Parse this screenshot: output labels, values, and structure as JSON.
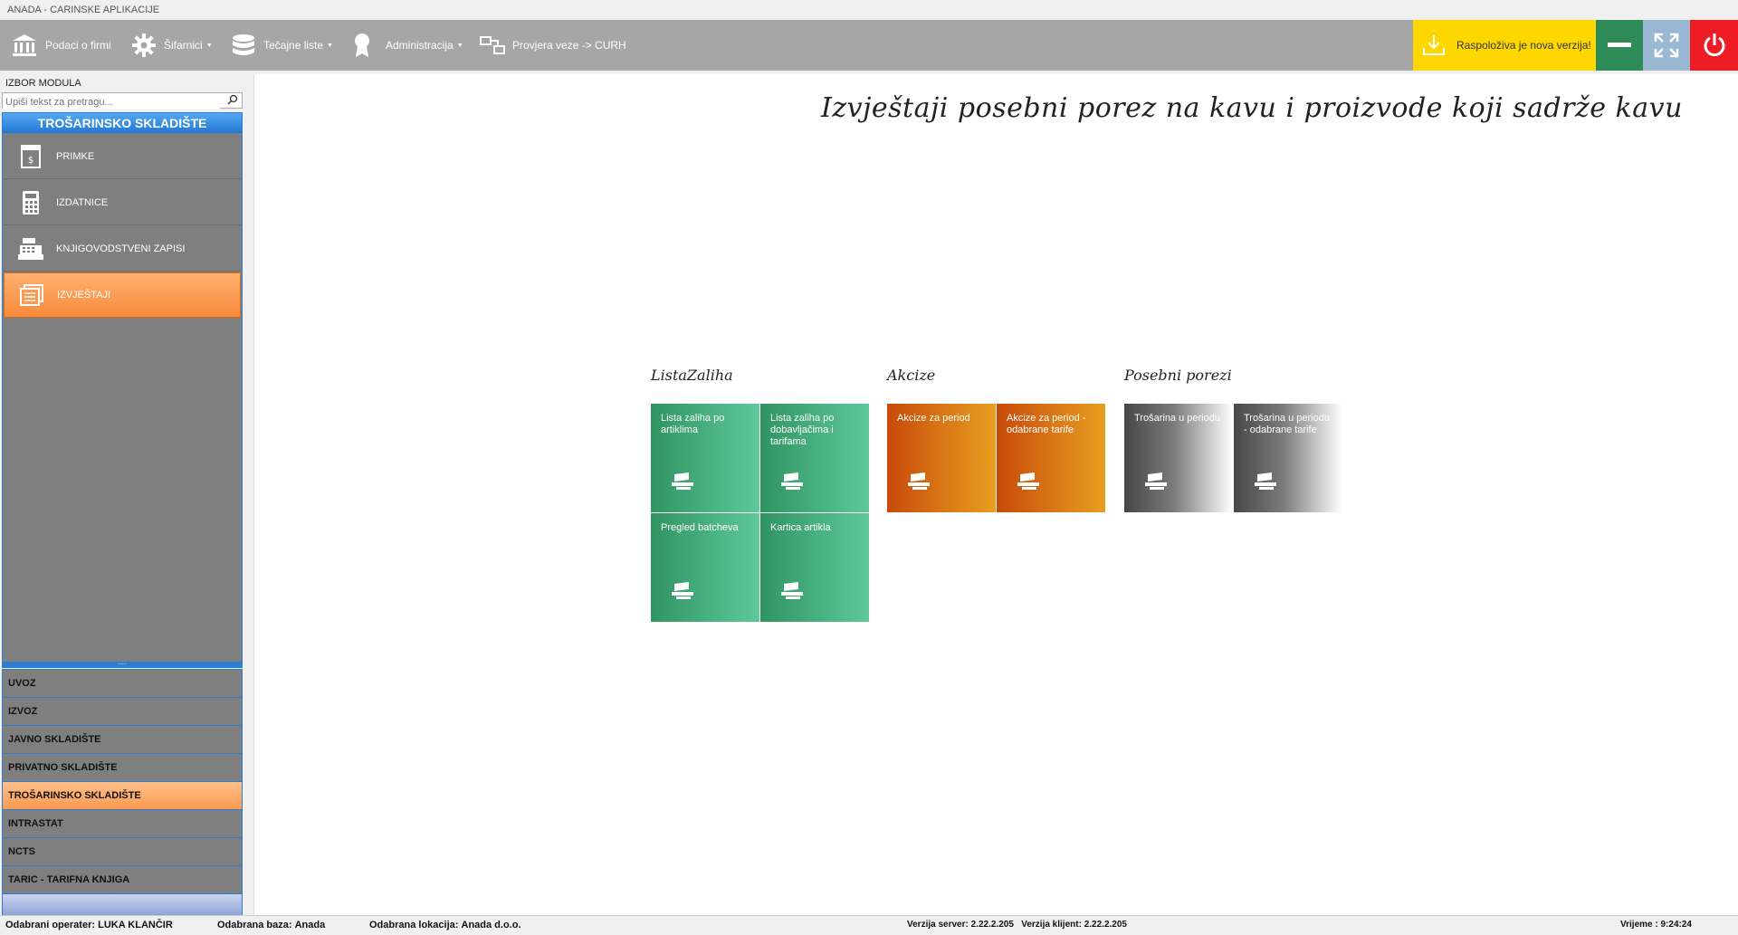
{
  "window": {
    "title": "ANADA - CARINSKE APLIKACIJE"
  },
  "toolbar": {
    "items": [
      {
        "label": "Podaci o firmi",
        "icon": "bank-icon"
      },
      {
        "label": "Šifarnici",
        "icon": "gear-icon"
      },
      {
        "label": "Tečajne liste",
        "icon": "database-icon"
      },
      {
        "label": "Administracija",
        "icon": "award-icon"
      },
      {
        "label": "Provjera veze -> CURH",
        "icon": "network-icon"
      }
    ],
    "update_label": "Raspoloživa je nova verzija!",
    "colors": {
      "update": "#ffd700",
      "minimize": "#2e8b57",
      "maximize": "#9ab7d3",
      "close": "#ee1c25"
    }
  },
  "sidebar": {
    "izbor_label": "IZBOR MODULA",
    "search_placeholder": "Upiši tekst za pretragu...",
    "module_title": "TROŠARINSKO SKLADIŠTE",
    "items": [
      {
        "label": "PRIMKE",
        "icon": "receipt-icon"
      },
      {
        "label": "IZDATNICE",
        "icon": "calculator-icon"
      },
      {
        "label": "KNJIGOVODSTVENI ZAPISI",
        "icon": "cash-register-icon"
      },
      {
        "label": "IZVJEŠTAJI",
        "icon": "reports-icon",
        "active": true
      }
    ],
    "modules": [
      {
        "label": "UVOZ"
      },
      {
        "label": "IZVOZ"
      },
      {
        "label": "JAVNO SKLADIŠTE"
      },
      {
        "label": "PRIVATNO SKLADIŠTE"
      },
      {
        "label": "TROŠARINSKO SKLADIŠTE",
        "active": true
      },
      {
        "label": "INTRASTAT"
      },
      {
        "label": "NCTS"
      },
      {
        "label": "TARIC - TARIFNA KNJIGA"
      }
    ]
  },
  "main": {
    "title": "Izvještaji posebni porez na kavu i proizvode koji sadrže kavu",
    "groups": [
      {
        "title": "ListaZaliha",
        "tiles": [
          "Lista zaliha po artiklima",
          "Lista zaliha po dobavljačima i tarifama",
          "Pregled batcheva",
          "Kartica artikla"
        ]
      },
      {
        "title": "Akcize",
        "tiles": [
          "Akcize za period",
          "Akcize za period - odabrane tarife"
        ]
      },
      {
        "title": "Posebni porezi",
        "tiles": [
          "Trošarina u periodu",
          "Trošarina u periodu - odabrane tarife"
        ]
      }
    ]
  },
  "status": {
    "operater_label": "Odabrani operater:",
    "operater_value": "LUKA KLANČIR",
    "baza_label": "Odabrana baza:",
    "baza_value": "Anada",
    "lokacija_label": "Odabrana lokacija:",
    "lokacija_value": "Anada d.o.o.",
    "verzija_server_label": "Verzija server:",
    "verzija_server_value": "2.22.2.205",
    "verzija_klijent_label": "Verzija klijent:",
    "verzija_klijent_value": "2.22.2.205",
    "vrijeme_label": "Vrijeme :",
    "vrijeme_value": "9:24:24"
  }
}
